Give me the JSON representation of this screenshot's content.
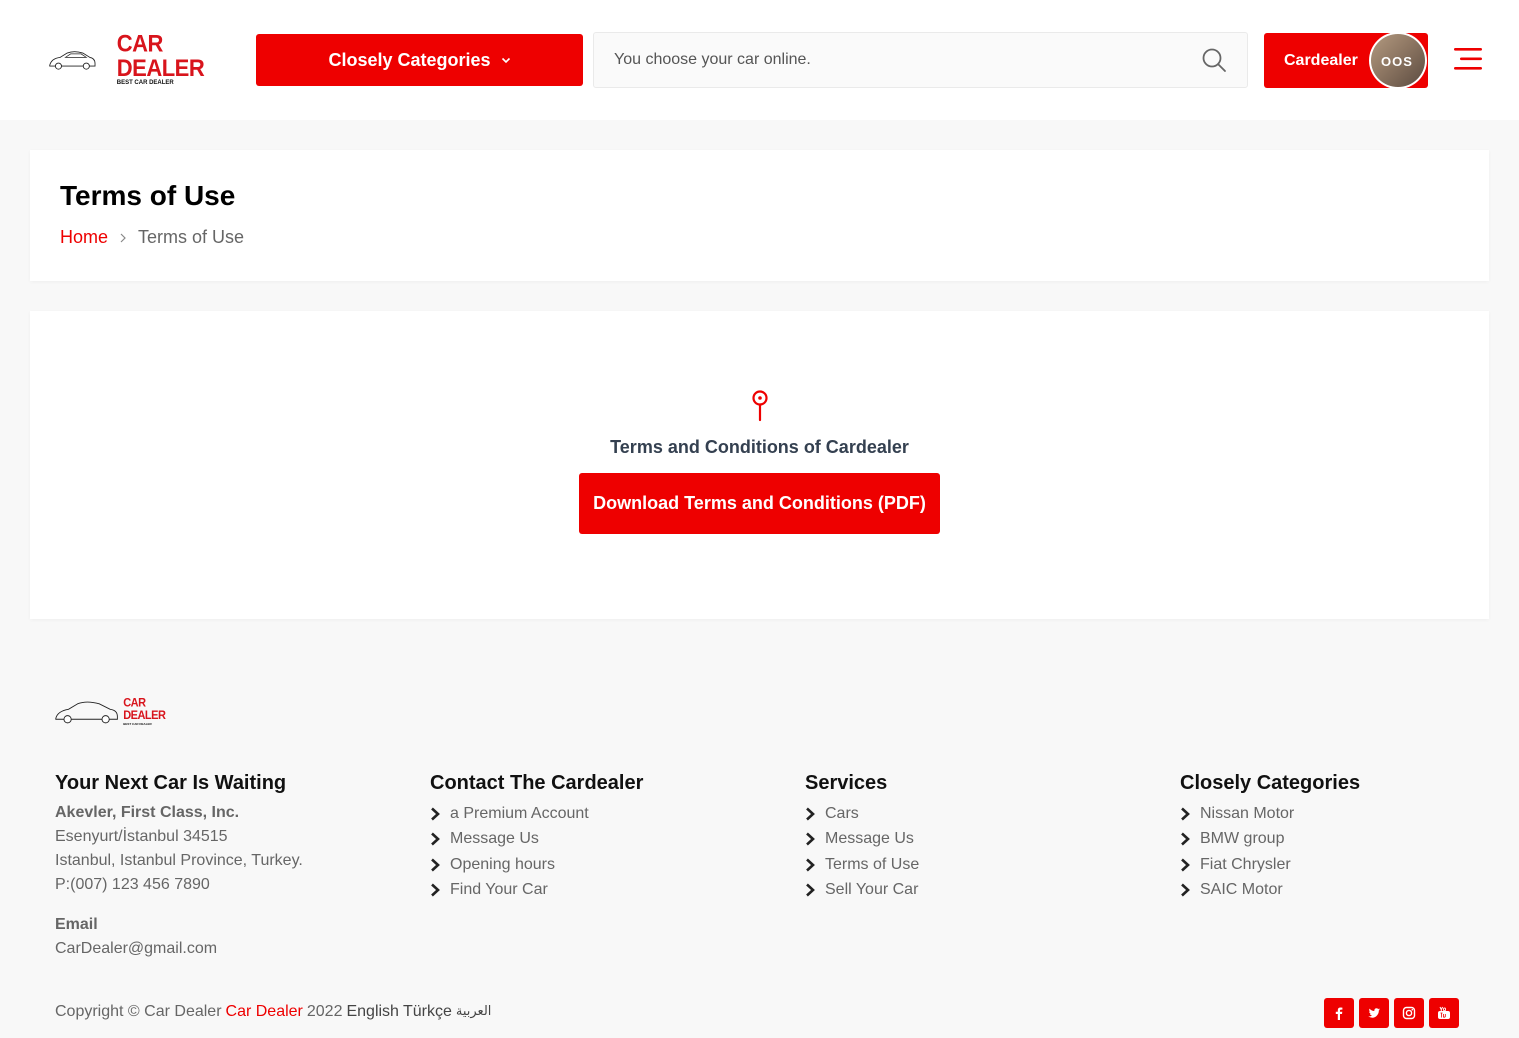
{
  "header": {
    "logo_title": "CAR DEALER",
    "logo_subtitle": "BEST CAR DEALER",
    "categories_label": "Closely Categories",
    "search_placeholder": "You choose your car online.",
    "dealer_label": "Cardealer",
    "avatar_text": "OOS"
  },
  "title_panel": {
    "title": "Terms of Use",
    "breadcrumb_home": "Home",
    "breadcrumb_current": "Terms of Use"
  },
  "content": {
    "heading": "Terms and Conditions of Cardealer",
    "download_label": "Download Terms and Conditions (PDF)"
  },
  "footer": {
    "logo_title": "CAR DEALER",
    "logo_subtitle": "BEST CAR DEALER",
    "col1": {
      "title": "Your Next Car Is Waiting",
      "company": "Akevler, First Class, Inc.",
      "address1": "Esenyurt/İstanbul 34515",
      "address2": "Istanbul, Istanbul Province, Turkey.",
      "phone": "P:(007) 123 456 7890",
      "email_label": "Email",
      "email": "CarDealer@gmail.com"
    },
    "col2": {
      "title": "Contact The Cardealer",
      "items": [
        "a Premium Account",
        "Message Us",
        "Opening hours",
        "Find Your Car"
      ]
    },
    "col3": {
      "title": "Services",
      "items": [
        "Cars",
        "Message Us",
        "Terms of Use",
        "Sell Your Car"
      ]
    },
    "col4": {
      "title": "Closely Categories",
      "items": [
        "Nissan Motor",
        "BMW group",
        "Fiat Chrysler",
        "SAIC Motor"
      ]
    },
    "copyright_prefix": "Copyright © Car Dealer",
    "copyright_link": "Car Dealer",
    "copyright_year": "2022",
    "languages": [
      "English",
      "Türkçe",
      "العربية"
    ]
  },
  "colors": {
    "accent": "#ee0000",
    "background": "#f8f8f8"
  },
  "icons": [
    "car-logo-icon",
    "chevron-down-icon",
    "search-icon",
    "hamburger-menu-icon",
    "map-pin-icon",
    "chevron-right-icon",
    "facebook-icon",
    "twitter-icon",
    "instagram-icon",
    "youtube-icon"
  ]
}
